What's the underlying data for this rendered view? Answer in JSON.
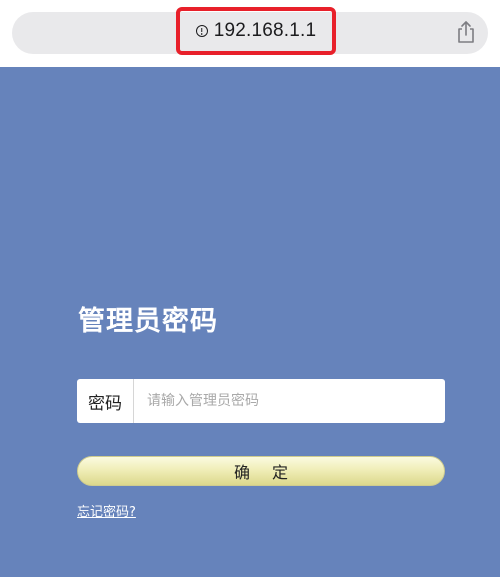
{
  "browser": {
    "url": "192.168.1.1"
  },
  "login": {
    "title": "管理员密码",
    "password_label": "密码",
    "password_placeholder": "请输入管理员密码",
    "password_value": "",
    "confirm_label": "确定",
    "forgot_link": "忘记密码?"
  },
  "colors": {
    "background": "#6683bb",
    "highlight_border": "#e8202a",
    "button": "#f0eeb8"
  },
  "icons": [
    "info-icon",
    "share-icon"
  ]
}
